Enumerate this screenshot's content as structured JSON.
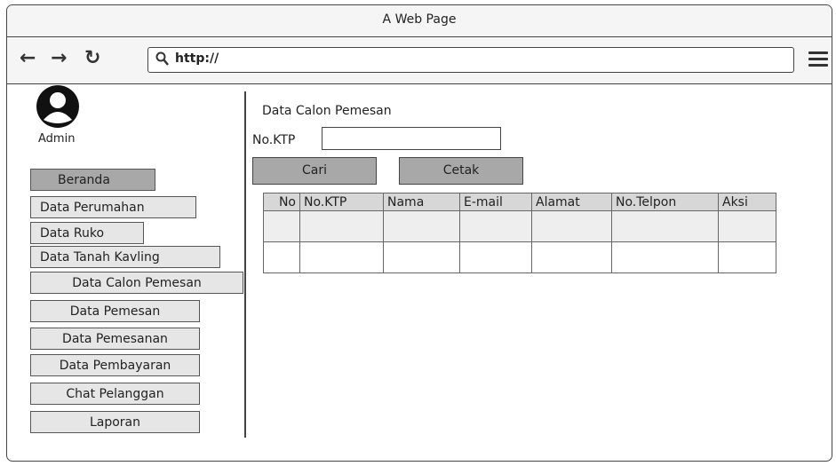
{
  "window": {
    "title": "A Web Page"
  },
  "browser": {
    "url": "http://",
    "back_icon": "back-arrow-icon",
    "forward_icon": "forward-arrow-icon",
    "reload_icon": "reload-icon",
    "menu_icon": "hamburger-menu-icon"
  },
  "sidebar": {
    "user_label": "Admin",
    "items": [
      {
        "label": "Beranda",
        "active": true
      },
      {
        "label": "Data Perumahan"
      },
      {
        "label": "Data Ruko"
      },
      {
        "label": "Data Tanah Kavling"
      },
      {
        "label": "Data Calon Pemesan"
      },
      {
        "label": "Data Pemesan"
      },
      {
        "label": "Data Pemesanan"
      },
      {
        "label": "Data Pembayaran"
      },
      {
        "label": "Chat Pelanggan"
      },
      {
        "label": "Laporan"
      }
    ]
  },
  "main": {
    "title": "Data Calon Pemesan",
    "ktp_label": "No.KTP",
    "ktp_value": "",
    "search_button": "Cari",
    "print_button": "Cetak",
    "table": {
      "headers": [
        "No",
        "No.KTP",
        "Nama",
        "E-mail",
        "Alamat",
        "No.Telpon",
        "Aksi"
      ],
      "rows": [
        [
          "",
          "",
          "",
          "",
          "",
          "",
          ""
        ],
        [
          "",
          "",
          "",
          "",
          "",
          "",
          ""
        ]
      ]
    }
  },
  "colors": {
    "active_button": "#a8a8a8",
    "button": "#e6e6e6",
    "header_row": "#d7d7d7"
  }
}
